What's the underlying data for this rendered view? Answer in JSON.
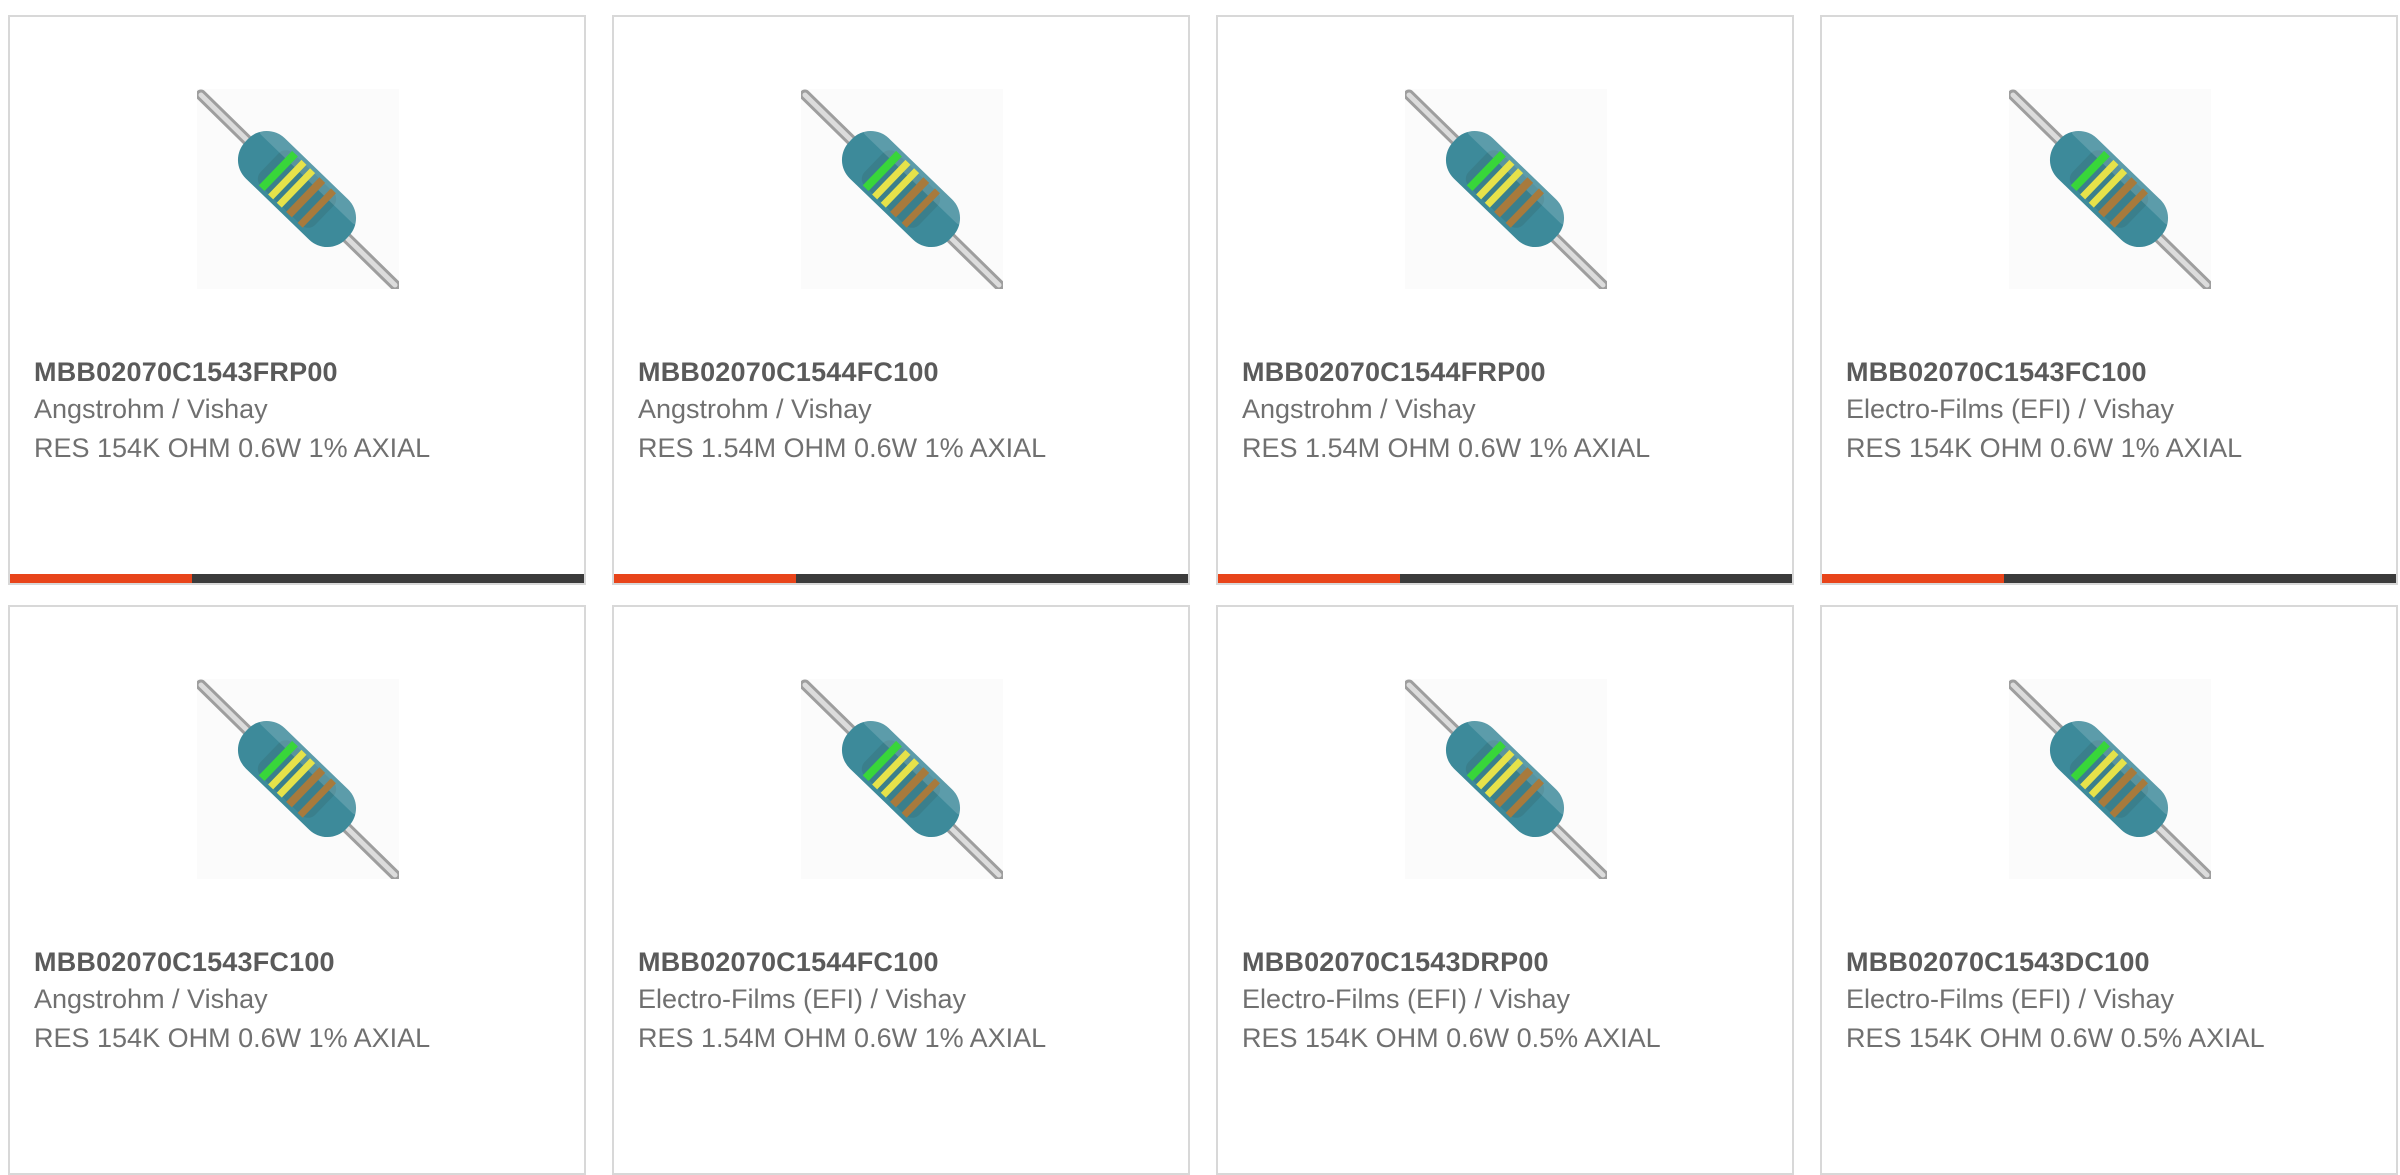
{
  "colors": {
    "accent": "#e8441a",
    "bar": "#3b3b3b",
    "resistor_body": "#3d8a9a",
    "band_green": "#38d63a",
    "band_yellow": "#e6e24a",
    "band_brown": "#a87a3c"
  },
  "cards": [
    {
      "part": "MBB02070C1543FRP00",
      "manufacturer": "Angstrohm / Vishay",
      "description": "RES 154K OHM 0.6W 1% AXIAL",
      "image_icon": "axial-resistor-icon"
    },
    {
      "part": "MBB02070C1544FC100",
      "manufacturer": "Angstrohm / Vishay",
      "description": "RES 1.54M OHM 0.6W 1% AXIAL",
      "image_icon": "axial-resistor-icon"
    },
    {
      "part": "MBB02070C1544FRP00",
      "manufacturer": "Angstrohm / Vishay",
      "description": "RES 1.54M OHM 0.6W 1% AXIAL",
      "image_icon": "axial-resistor-icon"
    },
    {
      "part": "MBB02070C1543FC100",
      "manufacturer": "Electro-Films (EFI) / Vishay",
      "description": "RES 154K OHM 0.6W 1% AXIAL",
      "image_icon": "axial-resistor-icon"
    },
    {
      "part": "MBB02070C1543FC100",
      "manufacturer": "Angstrohm / Vishay",
      "description": "RES 154K OHM 0.6W 1% AXIAL",
      "image_icon": "axial-resistor-icon"
    },
    {
      "part": "MBB02070C1544FC100",
      "manufacturer": "Electro-Films (EFI) / Vishay",
      "description": "RES 1.54M OHM 0.6W 1% AXIAL",
      "image_icon": "axial-resistor-icon"
    },
    {
      "part": "MBB02070C1543DRP00",
      "manufacturer": "Electro-Films (EFI) / Vishay",
      "description": "RES 154K OHM 0.6W 0.5% AXIAL",
      "image_icon": "axial-resistor-icon"
    },
    {
      "part": "MBB02070C1543DC100",
      "manufacturer": "Electro-Films (EFI) / Vishay",
      "description": "RES 154K OHM 0.6W 0.5% AXIAL",
      "image_icon": "axial-resistor-icon"
    }
  ]
}
